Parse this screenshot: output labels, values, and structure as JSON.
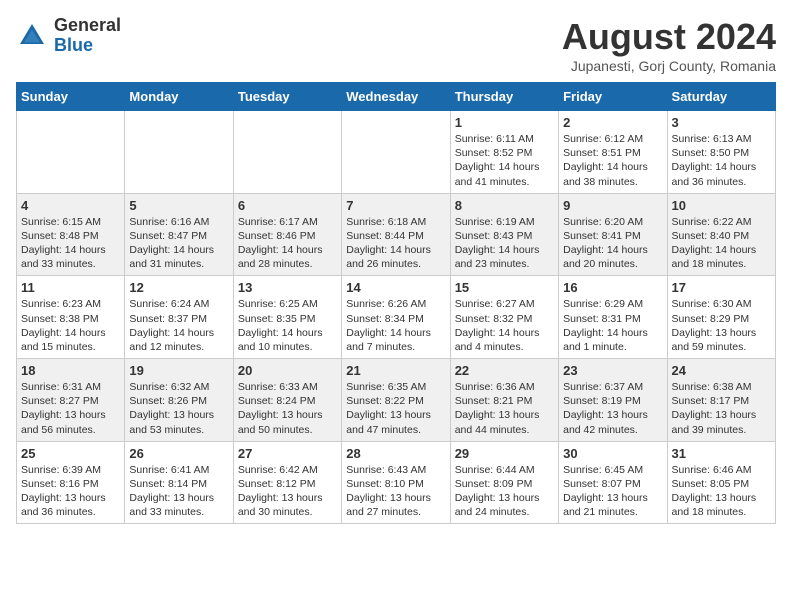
{
  "logo": {
    "general": "General",
    "blue": "Blue"
  },
  "title": "August 2024",
  "location": "Jupanesti, Gorj County, Romania",
  "weekdays": [
    "Sunday",
    "Monday",
    "Tuesday",
    "Wednesday",
    "Thursday",
    "Friday",
    "Saturday"
  ],
  "weeks": [
    [
      {
        "day": "",
        "info": ""
      },
      {
        "day": "",
        "info": ""
      },
      {
        "day": "",
        "info": ""
      },
      {
        "day": "",
        "info": ""
      },
      {
        "day": "1",
        "info": "Sunrise: 6:11 AM\nSunset: 8:52 PM\nDaylight: 14 hours\nand 41 minutes."
      },
      {
        "day": "2",
        "info": "Sunrise: 6:12 AM\nSunset: 8:51 PM\nDaylight: 14 hours\nand 38 minutes."
      },
      {
        "day": "3",
        "info": "Sunrise: 6:13 AM\nSunset: 8:50 PM\nDaylight: 14 hours\nand 36 minutes."
      }
    ],
    [
      {
        "day": "4",
        "info": "Sunrise: 6:15 AM\nSunset: 8:48 PM\nDaylight: 14 hours\nand 33 minutes."
      },
      {
        "day": "5",
        "info": "Sunrise: 6:16 AM\nSunset: 8:47 PM\nDaylight: 14 hours\nand 31 minutes."
      },
      {
        "day": "6",
        "info": "Sunrise: 6:17 AM\nSunset: 8:46 PM\nDaylight: 14 hours\nand 28 minutes."
      },
      {
        "day": "7",
        "info": "Sunrise: 6:18 AM\nSunset: 8:44 PM\nDaylight: 14 hours\nand 26 minutes."
      },
      {
        "day": "8",
        "info": "Sunrise: 6:19 AM\nSunset: 8:43 PM\nDaylight: 14 hours\nand 23 minutes."
      },
      {
        "day": "9",
        "info": "Sunrise: 6:20 AM\nSunset: 8:41 PM\nDaylight: 14 hours\nand 20 minutes."
      },
      {
        "day": "10",
        "info": "Sunrise: 6:22 AM\nSunset: 8:40 PM\nDaylight: 14 hours\nand 18 minutes."
      }
    ],
    [
      {
        "day": "11",
        "info": "Sunrise: 6:23 AM\nSunset: 8:38 PM\nDaylight: 14 hours\nand 15 minutes."
      },
      {
        "day": "12",
        "info": "Sunrise: 6:24 AM\nSunset: 8:37 PM\nDaylight: 14 hours\nand 12 minutes."
      },
      {
        "day": "13",
        "info": "Sunrise: 6:25 AM\nSunset: 8:35 PM\nDaylight: 14 hours\nand 10 minutes."
      },
      {
        "day": "14",
        "info": "Sunrise: 6:26 AM\nSunset: 8:34 PM\nDaylight: 14 hours\nand 7 minutes."
      },
      {
        "day": "15",
        "info": "Sunrise: 6:27 AM\nSunset: 8:32 PM\nDaylight: 14 hours\nand 4 minutes."
      },
      {
        "day": "16",
        "info": "Sunrise: 6:29 AM\nSunset: 8:31 PM\nDaylight: 14 hours\nand 1 minute."
      },
      {
        "day": "17",
        "info": "Sunrise: 6:30 AM\nSunset: 8:29 PM\nDaylight: 13 hours\nand 59 minutes."
      }
    ],
    [
      {
        "day": "18",
        "info": "Sunrise: 6:31 AM\nSunset: 8:27 PM\nDaylight: 13 hours\nand 56 minutes."
      },
      {
        "day": "19",
        "info": "Sunrise: 6:32 AM\nSunset: 8:26 PM\nDaylight: 13 hours\nand 53 minutes."
      },
      {
        "day": "20",
        "info": "Sunrise: 6:33 AM\nSunset: 8:24 PM\nDaylight: 13 hours\nand 50 minutes."
      },
      {
        "day": "21",
        "info": "Sunrise: 6:35 AM\nSunset: 8:22 PM\nDaylight: 13 hours\nand 47 minutes."
      },
      {
        "day": "22",
        "info": "Sunrise: 6:36 AM\nSunset: 8:21 PM\nDaylight: 13 hours\nand 44 minutes."
      },
      {
        "day": "23",
        "info": "Sunrise: 6:37 AM\nSunset: 8:19 PM\nDaylight: 13 hours\nand 42 minutes."
      },
      {
        "day": "24",
        "info": "Sunrise: 6:38 AM\nSunset: 8:17 PM\nDaylight: 13 hours\nand 39 minutes."
      }
    ],
    [
      {
        "day": "25",
        "info": "Sunrise: 6:39 AM\nSunset: 8:16 PM\nDaylight: 13 hours\nand 36 minutes."
      },
      {
        "day": "26",
        "info": "Sunrise: 6:41 AM\nSunset: 8:14 PM\nDaylight: 13 hours\nand 33 minutes."
      },
      {
        "day": "27",
        "info": "Sunrise: 6:42 AM\nSunset: 8:12 PM\nDaylight: 13 hours\nand 30 minutes."
      },
      {
        "day": "28",
        "info": "Sunrise: 6:43 AM\nSunset: 8:10 PM\nDaylight: 13 hours\nand 27 minutes."
      },
      {
        "day": "29",
        "info": "Sunrise: 6:44 AM\nSunset: 8:09 PM\nDaylight: 13 hours\nand 24 minutes."
      },
      {
        "day": "30",
        "info": "Sunrise: 6:45 AM\nSunset: 8:07 PM\nDaylight: 13 hours\nand 21 minutes."
      },
      {
        "day": "31",
        "info": "Sunrise: 6:46 AM\nSunset: 8:05 PM\nDaylight: 13 hours\nand 18 minutes."
      }
    ]
  ]
}
